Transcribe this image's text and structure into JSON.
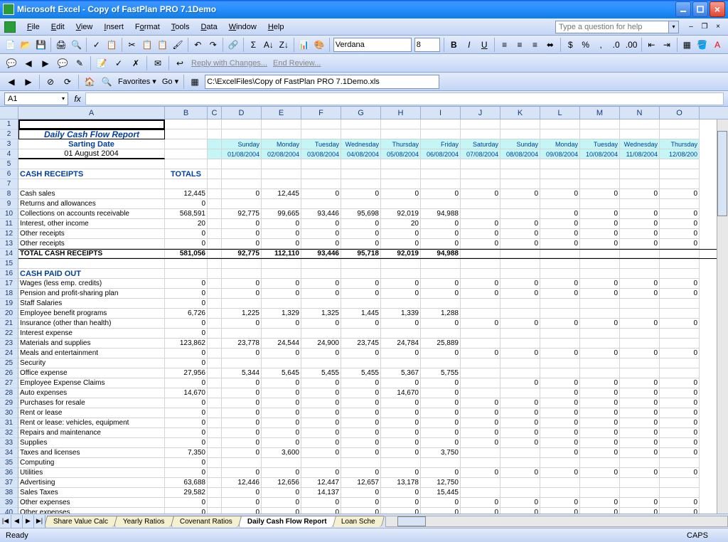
{
  "app": {
    "title": "Microsoft Excel - Copy of FastPlan PRO 7.1Demo"
  },
  "menu": {
    "file": "File",
    "edit": "Edit",
    "view": "View",
    "insert": "Insert",
    "format": "Format",
    "tools": "Tools",
    "data": "Data",
    "window": "Window",
    "help": "Help",
    "help_placeholder": "Type a question for help"
  },
  "toolbar2": {
    "font": "Verdana",
    "size": "8"
  },
  "toolbar3": {
    "reply": "Reply with Changes...",
    "end": "End Review..."
  },
  "toolbar4": {
    "favorites": "Favorites",
    "go": "Go",
    "path": "C:\\ExcelFiles\\Copy of FastPlan PRO 7.1Demo.xls"
  },
  "namebox": "A1",
  "columns": [
    "A",
    "B",
    "C",
    "D",
    "E",
    "F",
    "G",
    "H",
    "I",
    "J",
    "K",
    "L",
    "M",
    "N",
    "O"
  ],
  "sheet": {
    "title": "Daily Cash Flow Report",
    "subtitle": "Sarting Date",
    "date": "01 August 2004",
    "days": [
      "Sunday",
      "Monday",
      "Tuesday",
      "Wednesday",
      "Thursday",
      "Friday",
      "Saturday",
      "Sunday",
      "Monday",
      "Tuesday",
      "Wednesday",
      "Thursday"
    ],
    "dates": [
      "01/08/2004",
      "02/08/2004",
      "03/08/2004",
      "04/08/2004",
      "05/08/2004",
      "06/08/2004",
      "07/08/2004",
      "08/08/2004",
      "09/08/2004",
      "10/08/2004",
      "11/08/2004",
      "12/08/200"
    ],
    "receipts_hdr": "CASH RECEIPTS",
    "totals_hdr": "TOTALS",
    "rows_receipts": [
      {
        "n": 8,
        "label": "Cash sales",
        "total": "12,445",
        "vals": [
          "0",
          "12,445",
          "0",
          "0",
          "0",
          "0",
          "0",
          "0",
          "0",
          "0",
          "0",
          "0"
        ]
      },
      {
        "n": 9,
        "label": "Returns and allowances",
        "total": "0",
        "vals": [
          "",
          "",
          "",
          "",
          "",
          "",
          "",
          "",
          "",
          "",
          "",
          ""
        ]
      },
      {
        "n": 10,
        "label": "Collections on accounts receivable",
        "total": "568,591",
        "vals": [
          "92,775",
          "99,665",
          "93,446",
          "95,698",
          "92,019",
          "94,988",
          "",
          "",
          "0",
          "0",
          "0",
          "0"
        ]
      },
      {
        "n": 11,
        "label": "Interest, other income",
        "total": "20",
        "vals": [
          "0",
          "0",
          "0",
          "0",
          "20",
          "0",
          "0",
          "0",
          "0",
          "0",
          "0",
          "0"
        ]
      },
      {
        "n": 12,
        "label": "Other receipts",
        "total": "0",
        "vals": [
          "0",
          "0",
          "0",
          "0",
          "0",
          "0",
          "0",
          "0",
          "0",
          "0",
          "0",
          "0"
        ]
      },
      {
        "n": 13,
        "label": "Other receipts",
        "total": "0",
        "vals": [
          "0",
          "0",
          "0",
          "0",
          "0",
          "0",
          "0",
          "0",
          "0",
          "0",
          "0",
          "0"
        ]
      }
    ],
    "total_receipts": {
      "n": 14,
      "label": "TOTAL CASH RECEIPTS",
      "total": "581,056",
      "vals": [
        "92,775",
        "112,110",
        "93,446",
        "95,718",
        "92,019",
        "94,988",
        "",
        "",
        "",
        "",
        "",
        ""
      ]
    },
    "paidout_hdr": "CASH PAID OUT",
    "rows_paidout": [
      {
        "n": 17,
        "label": "Wages (less emp. credits)",
        "total": "0",
        "vals": [
          "0",
          "0",
          "0",
          "0",
          "0",
          "0",
          "0",
          "0",
          "0",
          "0",
          "0",
          "0"
        ]
      },
      {
        "n": 18,
        "label": "Pension and profit-sharing plan",
        "total": "0",
        "vals": [
          "0",
          "0",
          "0",
          "0",
          "0",
          "0",
          "0",
          "0",
          "0",
          "0",
          "0",
          "0"
        ]
      },
      {
        "n": 19,
        "label": "Staff Salaries",
        "total": "0",
        "vals": [
          "",
          "",
          "",
          "",
          "",
          "",
          "",
          "",
          "",
          "",
          "",
          ""
        ]
      },
      {
        "n": 20,
        "label": "Employee benefit programs",
        "total": "6,726",
        "vals": [
          "1,225",
          "1,329",
          "1,325",
          "1,445",
          "1,339",
          "1,288",
          "",
          "",
          "",
          "",
          "",
          ""
        ]
      },
      {
        "n": 21,
        "label": "Insurance (other than health)",
        "total": "0",
        "vals": [
          "0",
          "0",
          "0",
          "0",
          "0",
          "0",
          "0",
          "0",
          "0",
          "0",
          "0",
          "0"
        ]
      },
      {
        "n": 22,
        "label": "Interest expense",
        "total": "0",
        "vals": [
          "",
          "",
          "",
          "",
          "",
          "",
          "",
          "",
          "",
          "",
          "",
          ""
        ]
      },
      {
        "n": 23,
        "label": "Materials and supplies",
        "total": "123,862",
        "vals": [
          "23,778",
          "24,544",
          "24,900",
          "23,745",
          "24,784",
          "25,889",
          "",
          "",
          "",
          "",
          "",
          ""
        ]
      },
      {
        "n": 24,
        "label": "Meals and entertainment",
        "total": "0",
        "vals": [
          "0",
          "0",
          "0",
          "0",
          "0",
          "0",
          "0",
          "0",
          "0",
          "0",
          "0",
          "0"
        ]
      },
      {
        "n": 25,
        "label": "Security",
        "total": "0",
        "vals": [
          "",
          "",
          "",
          "",
          "",
          "",
          "",
          "",
          "",
          "",
          "",
          ""
        ]
      },
      {
        "n": 26,
        "label": "Office expense",
        "total": "27,956",
        "vals": [
          "5,344",
          "5,645",
          "5,455",
          "5,455",
          "5,367",
          "5,755",
          "",
          "",
          "",
          "",
          "",
          ""
        ]
      },
      {
        "n": 27,
        "label": "Employee Expense Claims",
        "total": "0",
        "vals": [
          "0",
          "0",
          "0",
          "0",
          "0",
          "0",
          "",
          "0",
          "0",
          "0",
          "0",
          "0"
        ]
      },
      {
        "n": 28,
        "label": "Auto expenses",
        "total": "14,670",
        "vals": [
          "0",
          "0",
          "0",
          "0",
          "14,670",
          "0",
          "",
          "",
          "0",
          "0",
          "0",
          "0"
        ]
      },
      {
        "n": 29,
        "label": "Purchases for resale",
        "total": "0",
        "vals": [
          "0",
          "0",
          "0",
          "0",
          "0",
          "0",
          "0",
          "0",
          "0",
          "0",
          "0",
          "0"
        ]
      },
      {
        "n": 30,
        "label": "Rent or lease",
        "total": "0",
        "vals": [
          "0",
          "0",
          "0",
          "0",
          "0",
          "0",
          "0",
          "0",
          "0",
          "0",
          "0",
          "0"
        ]
      },
      {
        "n": 31,
        "label": "Rent or lease: vehicles, equipment",
        "total": "0",
        "vals": [
          "0",
          "0",
          "0",
          "0",
          "0",
          "0",
          "0",
          "0",
          "0",
          "0",
          "0",
          "0"
        ]
      },
      {
        "n": 32,
        "label": "Repairs and maintenance",
        "total": "0",
        "vals": [
          "0",
          "0",
          "0",
          "0",
          "0",
          "0",
          "0",
          "0",
          "0",
          "0",
          "0",
          "0"
        ]
      },
      {
        "n": 33,
        "label": "Supplies",
        "total": "0",
        "vals": [
          "0",
          "0",
          "0",
          "0",
          "0",
          "0",
          "0",
          "0",
          "0",
          "0",
          "0",
          "0"
        ]
      },
      {
        "n": 34,
        "label": "Taxes and licenses",
        "total": "7,350",
        "vals": [
          "0",
          "3,600",
          "0",
          "0",
          "0",
          "3,750",
          "",
          "",
          "0",
          "0",
          "0",
          "0"
        ]
      },
      {
        "n": 35,
        "label": "Computing",
        "total": "0",
        "vals": [
          "",
          "",
          "",
          "",
          "",
          "",
          "",
          "",
          "",
          "",
          "",
          ""
        ]
      },
      {
        "n": 36,
        "label": "Utilities",
        "total": "0",
        "vals": [
          "0",
          "0",
          "0",
          "0",
          "0",
          "0",
          "0",
          "0",
          "0",
          "0",
          "0",
          "0"
        ]
      },
      {
        "n": 37,
        "label": "Advertising",
        "total": "63,688",
        "vals": [
          "12,446",
          "12,656",
          "12,447",
          "12,657",
          "13,178",
          "12,750",
          "",
          "",
          "",
          "",
          "",
          ""
        ]
      },
      {
        "n": 38,
        "label": "Sales Taxes",
        "total": "29,582",
        "vals": [
          "0",
          "0",
          "14,137",
          "0",
          "0",
          "15,445",
          "",
          "",
          "",
          "",
          "",
          ""
        ]
      },
      {
        "n": 39,
        "label": "Other expenses",
        "total": "0",
        "vals": [
          "0",
          "0",
          "0",
          "0",
          "0",
          "0",
          "0",
          "0",
          "0",
          "0",
          "0",
          "0"
        ]
      },
      {
        "n": 40,
        "label": "Other expenses",
        "total": "0",
        "vals": [
          "0",
          "0",
          "0",
          "0",
          "0",
          "0",
          "0",
          "0",
          "0",
          "0",
          "0",
          "0"
        ]
      }
    ]
  },
  "tabs": {
    "t1": "Share Value Calc",
    "t2": "Yearly Ratios",
    "t3": "Covenant Ratios",
    "t4": "Daily Cash Flow Report",
    "t5": "Loan Sche"
  },
  "status": {
    "ready": "Ready",
    "caps": "CAPS"
  }
}
